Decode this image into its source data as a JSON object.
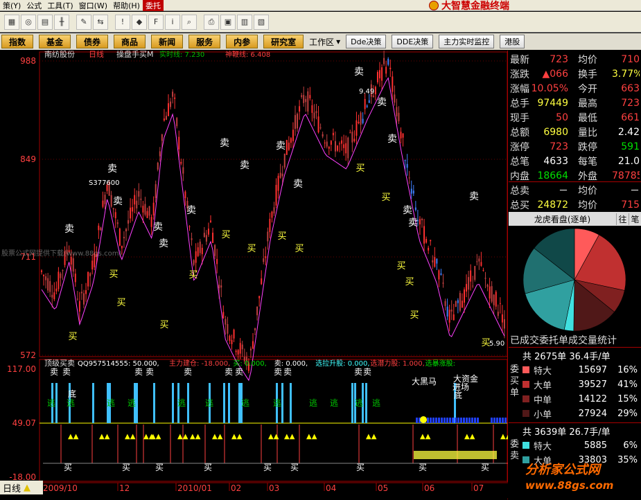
{
  "menubar": {
    "items": [
      "策(Y)",
      "公式",
      "工具(T)",
      "窗口(W)",
      "帮助(H)",
      "委托"
    ],
    "brand": "大智慧金融终端"
  },
  "navbar": {
    "buttons": [
      "指数",
      "基金",
      "债券",
      "商品",
      "新闻",
      "服务",
      "内参",
      "研究室"
    ],
    "workspace_label": "工作区",
    "tool_buttons": [
      "Dde决策",
      "DDE决策",
      "主力实时监控",
      "港股"
    ]
  },
  "chart": {
    "price_axis": [
      "988",
      "849",
      "711",
      "572"
    ],
    "stock_name": "南纺股份",
    "period": "日线",
    "indicator_name": "操盘手买M",
    "realtime_line": "实时线: 7.230",
    "shenbian_line": "神鞭线: 6.408",
    "high_label": "9.49",
    "low_label": "5.90",
    "prev_label": "S377600",
    "sub_axis": [
      "117.00",
      "49.07",
      "-18.00"
    ],
    "sub_title": "顶级买卖",
    "sub_params": [
      {
        "text": "QQ957514555: 50.000,",
        "color": "#ffffff"
      },
      {
        "text": "主力建仓: -18.000,",
        "color": "#ff4040"
      },
      {
        "text": "买: 0.000,",
        "color": "#00e000"
      },
      {
        "text": "卖: 0.000,",
        "color": "#ffffff"
      },
      {
        "text": "选拉升股: 0.000,",
        "color": "#40ffff"
      },
      {
        "text": "选潜力股: 1.000,",
        "color": "#ff4040"
      },
      {
        "text": "选暴涨股:",
        "color": "#00e000"
      }
    ],
    "sub_labels": [
      "大黑马",
      "大资金",
      "进场",
      "底",
      "底"
    ],
    "overlay_text": "股票公式网提供下载(www.88gs.com)",
    "date_axis": [
      "2009/10",
      "12",
      "2010/01",
      "02",
      "03",
      "04",
      "05",
      "06",
      "07"
    ],
    "buy_label": "买",
    "sell_label": "卖",
    "escape_label": "逃"
  },
  "quote": {
    "rows": [
      {
        "l": "最新",
        "v1": "723",
        "c1": "red",
        "l2": "均价",
        "v2": "710",
        "c2": "red"
      },
      {
        "l": "涨跌",
        "v1": "▲066",
        "c1": "red",
        "l2": "换手",
        "v2": "3.77%",
        "c2": "yel"
      },
      {
        "l": "涨幅",
        "v1": "10.05%",
        "c1": "red",
        "l2": "今开",
        "v2": "663",
        "c2": "red"
      },
      {
        "l": "总手",
        "v1": "97449",
        "c1": "yel",
        "l2": "最高",
        "v2": "723",
        "c2": "red"
      },
      {
        "l": "现手",
        "v1": "50",
        "c1": "red",
        "l2": "最低",
        "v2": "661",
        "c2": "red"
      },
      {
        "l": "总额",
        "v1": "6980",
        "c1": "yel",
        "l2": "量比",
        "v2": "2.42",
        "c2": "wht"
      },
      {
        "l": "涨停",
        "v1": "723",
        "c1": "red",
        "l2": "跌停",
        "v2": "591",
        "c2": "grn"
      },
      {
        "l": "总笔",
        "v1": "4633",
        "c1": "wht",
        "l2": "每笔",
        "v2": "21.0",
        "c2": "wht"
      },
      {
        "l": "内盘",
        "v1": "18664",
        "c1": "grn",
        "l2": "外盘",
        "v2": "78785",
        "c2": "red"
      },
      {
        "l": "总卖",
        "v1": "－",
        "c1": "wht",
        "l2": "均价",
        "v2": "－",
        "c2": "wht"
      },
      {
        "l": "总买",
        "v1": "24872",
        "c1": "yel",
        "l2": "均价",
        "v2": "715",
        "c2": "red"
      }
    ],
    "lh_title": "龙虎看盘(逐单)",
    "lh_btn1": "往",
    "lh_btn2": "笔",
    "stat_title": "已成交委托单成交量统计",
    "buy_summary": "共 2675单 36.4手/单",
    "sell_summary": "共 3639单 26.7手/单",
    "buy_side_label": "委买单",
    "sell_side_label": "委卖",
    "buy_rows": [
      {
        "n": "特大",
        "v": "15697",
        "p": "16%",
        "c": "#ff5a5a"
      },
      {
        "n": "大单",
        "v": "39527",
        "p": "41%",
        "c": "#c03030"
      },
      {
        "n": "中单",
        "v": "14122",
        "p": "15%",
        "c": "#802020"
      },
      {
        "n": "小单",
        "v": "27924",
        "p": "29%",
        "c": "#501818"
      }
    ],
    "sell_rows": [
      {
        "n": "特大",
        "v": "5885",
        "p": "6%",
        "c": "#40e0e0"
      },
      {
        "n": "大单",
        "v": "33803",
        "p": "35%",
        "c": "#30a0a0"
      }
    ]
  },
  "bottom_tab": "日线",
  "watermark": {
    "line1": "分析家公式网",
    "line2": "www.88gs.com"
  }
}
